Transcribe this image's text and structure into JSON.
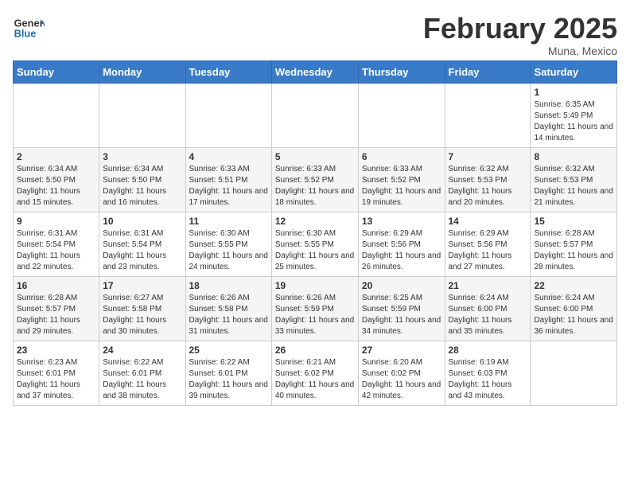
{
  "header": {
    "logo_general": "General",
    "logo_blue": "Blue",
    "month_title": "February 2025",
    "subtitle": "Muna, Mexico"
  },
  "weekdays": [
    "Sunday",
    "Monday",
    "Tuesday",
    "Wednesday",
    "Thursday",
    "Friday",
    "Saturday"
  ],
  "weeks": [
    [
      {
        "day": "",
        "info": ""
      },
      {
        "day": "",
        "info": ""
      },
      {
        "day": "",
        "info": ""
      },
      {
        "day": "",
        "info": ""
      },
      {
        "day": "",
        "info": ""
      },
      {
        "day": "",
        "info": ""
      },
      {
        "day": "1",
        "info": "Sunrise: 6:35 AM\nSunset: 5:49 PM\nDaylight: 11 hours and 14 minutes."
      }
    ],
    [
      {
        "day": "2",
        "info": "Sunrise: 6:34 AM\nSunset: 5:50 PM\nDaylight: 11 hours and 15 minutes."
      },
      {
        "day": "3",
        "info": "Sunrise: 6:34 AM\nSunset: 5:50 PM\nDaylight: 11 hours and 16 minutes."
      },
      {
        "day": "4",
        "info": "Sunrise: 6:33 AM\nSunset: 5:51 PM\nDaylight: 11 hours and 17 minutes."
      },
      {
        "day": "5",
        "info": "Sunrise: 6:33 AM\nSunset: 5:52 PM\nDaylight: 11 hours and 18 minutes."
      },
      {
        "day": "6",
        "info": "Sunrise: 6:33 AM\nSunset: 5:52 PM\nDaylight: 11 hours and 19 minutes."
      },
      {
        "day": "7",
        "info": "Sunrise: 6:32 AM\nSunset: 5:53 PM\nDaylight: 11 hours and 20 minutes."
      },
      {
        "day": "8",
        "info": "Sunrise: 6:32 AM\nSunset: 5:53 PM\nDaylight: 11 hours and 21 minutes."
      }
    ],
    [
      {
        "day": "9",
        "info": "Sunrise: 6:31 AM\nSunset: 5:54 PM\nDaylight: 11 hours and 22 minutes."
      },
      {
        "day": "10",
        "info": "Sunrise: 6:31 AM\nSunset: 5:54 PM\nDaylight: 11 hours and 23 minutes."
      },
      {
        "day": "11",
        "info": "Sunrise: 6:30 AM\nSunset: 5:55 PM\nDaylight: 11 hours and 24 minutes."
      },
      {
        "day": "12",
        "info": "Sunrise: 6:30 AM\nSunset: 5:55 PM\nDaylight: 11 hours and 25 minutes."
      },
      {
        "day": "13",
        "info": "Sunrise: 6:29 AM\nSunset: 5:56 PM\nDaylight: 11 hours and 26 minutes."
      },
      {
        "day": "14",
        "info": "Sunrise: 6:29 AM\nSunset: 5:56 PM\nDaylight: 11 hours and 27 minutes."
      },
      {
        "day": "15",
        "info": "Sunrise: 6:28 AM\nSunset: 5:57 PM\nDaylight: 11 hours and 28 minutes."
      }
    ],
    [
      {
        "day": "16",
        "info": "Sunrise: 6:28 AM\nSunset: 5:57 PM\nDaylight: 11 hours and 29 minutes."
      },
      {
        "day": "17",
        "info": "Sunrise: 6:27 AM\nSunset: 5:58 PM\nDaylight: 11 hours and 30 minutes."
      },
      {
        "day": "18",
        "info": "Sunrise: 6:26 AM\nSunset: 5:58 PM\nDaylight: 11 hours and 31 minutes."
      },
      {
        "day": "19",
        "info": "Sunrise: 6:26 AM\nSunset: 5:59 PM\nDaylight: 11 hours and 33 minutes."
      },
      {
        "day": "20",
        "info": "Sunrise: 6:25 AM\nSunset: 5:59 PM\nDaylight: 11 hours and 34 minutes."
      },
      {
        "day": "21",
        "info": "Sunrise: 6:24 AM\nSunset: 6:00 PM\nDaylight: 11 hours and 35 minutes."
      },
      {
        "day": "22",
        "info": "Sunrise: 6:24 AM\nSunset: 6:00 PM\nDaylight: 11 hours and 36 minutes."
      }
    ],
    [
      {
        "day": "23",
        "info": "Sunrise: 6:23 AM\nSunset: 6:01 PM\nDaylight: 11 hours and 37 minutes."
      },
      {
        "day": "24",
        "info": "Sunrise: 6:22 AM\nSunset: 6:01 PM\nDaylight: 11 hours and 38 minutes."
      },
      {
        "day": "25",
        "info": "Sunrise: 6:22 AM\nSunset: 6:01 PM\nDaylight: 11 hours and 39 minutes."
      },
      {
        "day": "26",
        "info": "Sunrise: 6:21 AM\nSunset: 6:02 PM\nDaylight: 11 hours and 40 minutes."
      },
      {
        "day": "27",
        "info": "Sunrise: 6:20 AM\nSunset: 6:02 PM\nDaylight: 11 hours and 42 minutes."
      },
      {
        "day": "28",
        "info": "Sunrise: 6:19 AM\nSunset: 6:03 PM\nDaylight: 11 hours and 43 minutes."
      },
      {
        "day": "",
        "info": ""
      }
    ]
  ]
}
